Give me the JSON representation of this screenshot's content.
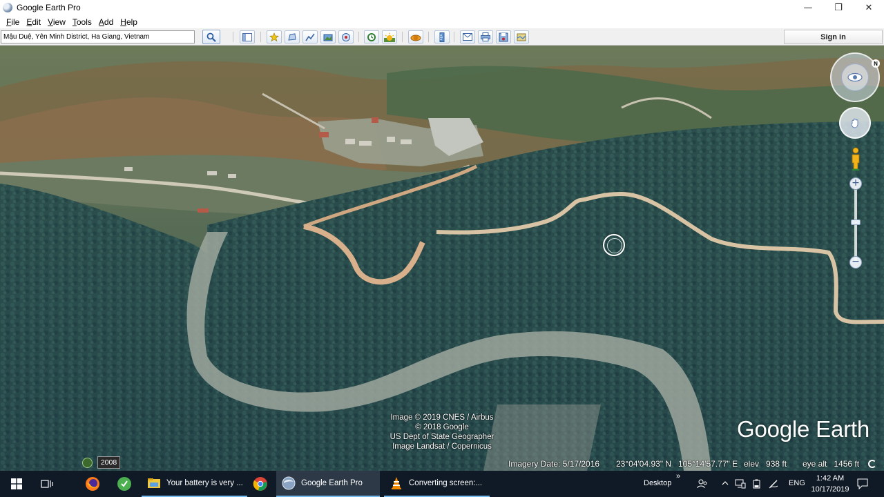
{
  "window": {
    "title": "Google Earth Pro",
    "controls": {
      "minimize": "—",
      "restore": "❐",
      "close": "✕"
    }
  },
  "menu": [
    "File",
    "Edit",
    "View",
    "Tools",
    "Add",
    "Help"
  ],
  "toolbar": {
    "search_value": "Mậu Duệ, Yên Minh District, Ha Giang, Vietnam",
    "sign_in": "Sign in",
    "icons": [
      "search-icon",
      "sidebar-toggle-icon",
      "placemark-icon",
      "polygon-icon",
      "path-icon",
      "image-overlay-icon",
      "record-tour-icon",
      "historical-imagery-icon",
      "sun-icon",
      "planets-icon",
      "ruler-icon",
      "email-icon",
      "print-icon",
      "save-image-icon",
      "view-in-maps-icon"
    ]
  },
  "map": {
    "attribution": [
      "Image © 2019 CNES / Airbus",
      "© 2018 Google",
      "US Dept of State Geographer",
      "Image Landsat / Copernicus"
    ],
    "logo": "Google Earth",
    "compass_north": "N",
    "year": "2008",
    "imagery_date": "Imagery Date: 5/17/2016",
    "latitude": "23°04'04.93\" N",
    "longitude": "105°14'57.77\" E",
    "elevation": "elev   938 ft",
    "eye_altitude": "eye alt   1456 ft"
  },
  "taskbar": {
    "tasks": [
      {
        "label": "Your battery is very ...",
        "icon": "file-explorer-icon"
      },
      {
        "label": "Google Earth Pro",
        "icon": "google-earth-icon"
      },
      {
        "label": "Converting screen:...",
        "icon": "vlc-icon"
      }
    ],
    "desktop": "Desktop",
    "desktop_chevron": "»",
    "language": "ENG",
    "time": "1:42 AM",
    "date": "10/17/2019"
  }
}
